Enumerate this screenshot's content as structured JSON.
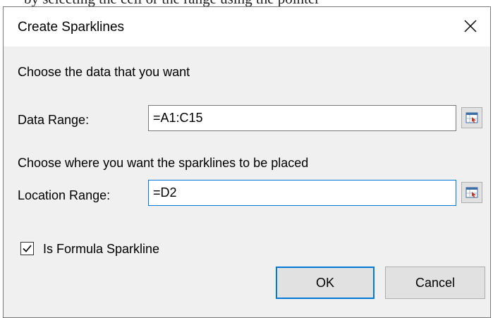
{
  "background_text": "by selecting the cell or the range using the pointer",
  "dialog": {
    "title": "Create Sparklines",
    "close_icon": "close-icon"
  },
  "data_section": {
    "heading": "Choose the data that you want",
    "label": "Data Range:",
    "value": "=A1:C15",
    "picker_icon": "range-picker-icon"
  },
  "location_section": {
    "heading": "Choose where you want the sparklines to be placed",
    "label": "Location Range:",
    "value": "=D2",
    "picker_icon": "range-picker-icon"
  },
  "formula_checkbox": {
    "label": "Is Formula Sparkline",
    "checked": true
  },
  "buttons": {
    "ok": "OK",
    "cancel": "Cancel"
  },
  "colors": {
    "accent": "#0078d7",
    "dialog_bg": "#f0f0f0",
    "titlebar_bg": "#ffffff"
  }
}
